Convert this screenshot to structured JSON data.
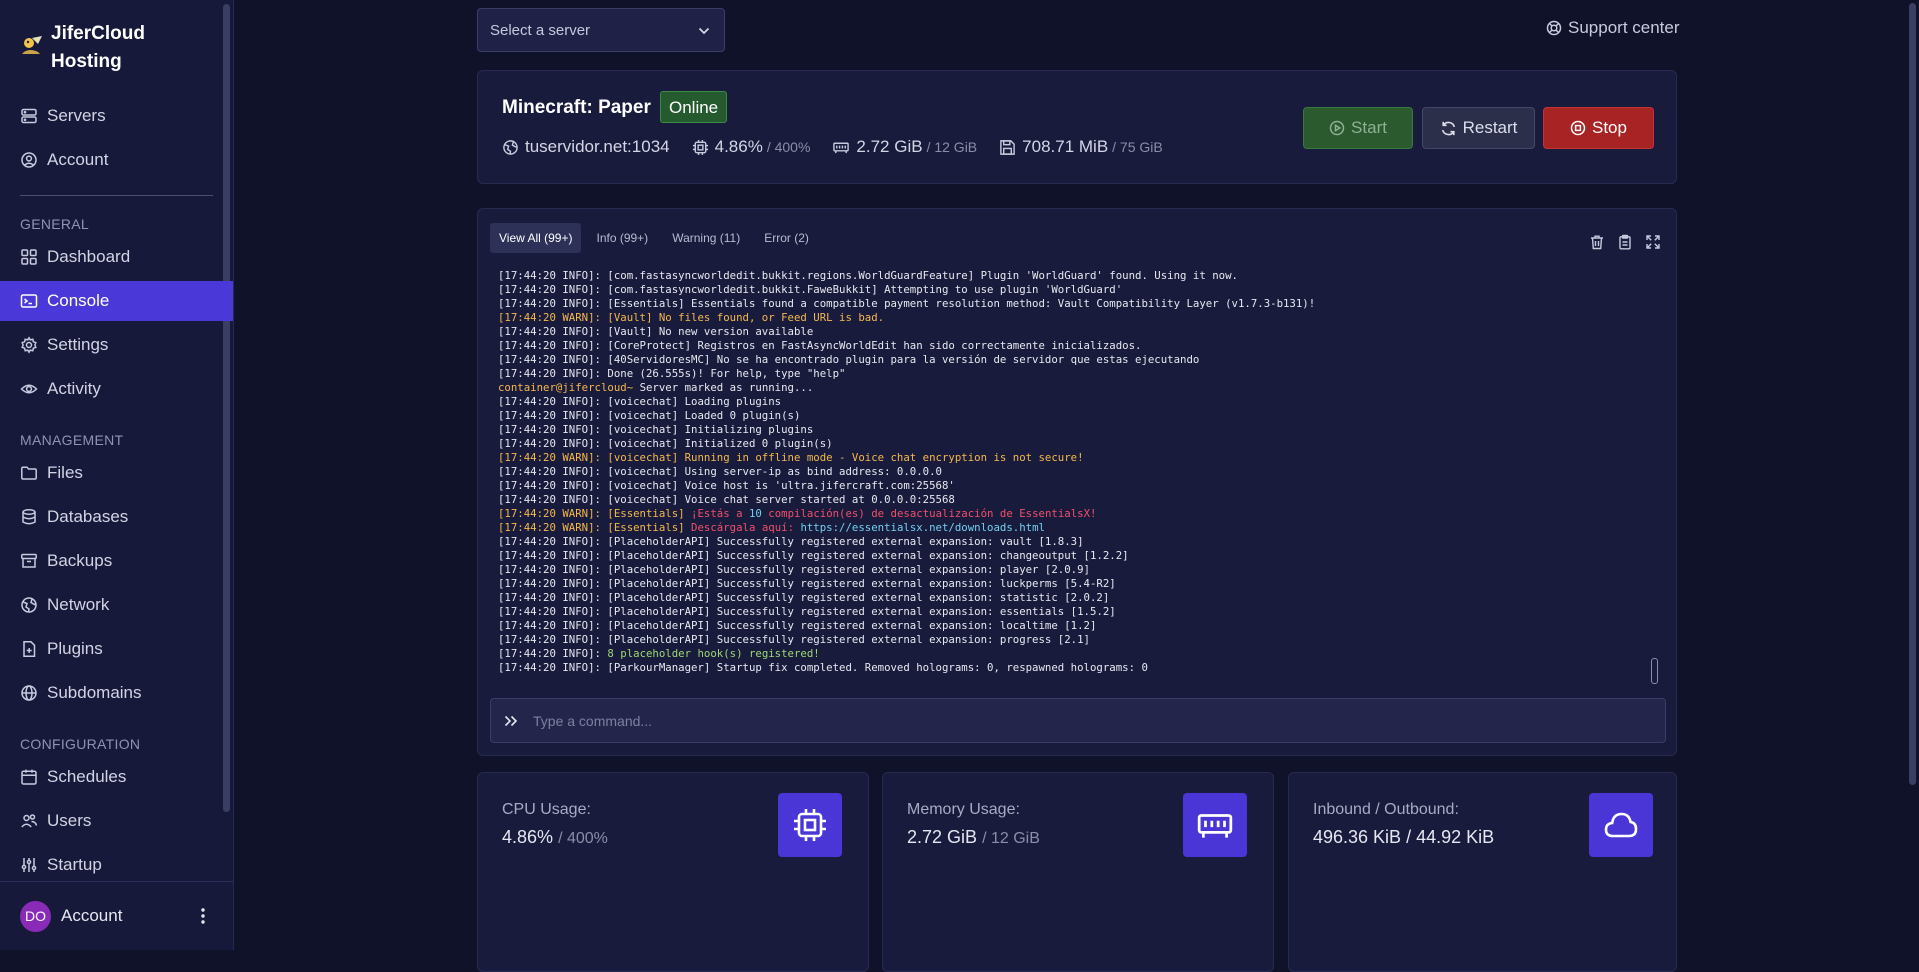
{
  "brand": {
    "title": "JiferCloud Hosting"
  },
  "nav": {
    "top": [
      {
        "label": "Servers",
        "icon": "server-icon"
      },
      {
        "label": "Account",
        "icon": "user-circle-icon"
      }
    ],
    "general_label": "GENERAL",
    "general": [
      {
        "label": "Dashboard",
        "icon": "grid-icon"
      },
      {
        "label": "Console",
        "icon": "terminal-icon",
        "active": true
      },
      {
        "label": "Settings",
        "icon": "gear-icon"
      },
      {
        "label": "Activity",
        "icon": "eye-icon"
      }
    ],
    "management_label": "MANAGEMENT",
    "management": [
      {
        "label": "Files",
        "icon": "folder-icon"
      },
      {
        "label": "Databases",
        "icon": "database-icon"
      },
      {
        "label": "Backups",
        "icon": "archive-icon"
      },
      {
        "label": "Network",
        "icon": "globe-network-icon"
      },
      {
        "label": "Plugins",
        "icon": "file-plus-icon"
      },
      {
        "label": "Subdomains",
        "icon": "globe-icon"
      }
    ],
    "configuration_label": "CONFIGURATION",
    "configuration": [
      {
        "label": "Schedules",
        "icon": "calendar-icon"
      },
      {
        "label": "Users",
        "icon": "users-icon"
      },
      {
        "label": "Startup",
        "icon": "sliders-icon"
      }
    ],
    "account": {
      "initials": "DO",
      "label": "Account"
    }
  },
  "header": {
    "server_select_placeholder": "Select a server",
    "support_label": "Support center"
  },
  "server": {
    "name": "Minecraft: Paper",
    "status": "Online",
    "address": "tuservidor.net:1034",
    "cpu": "4.86%",
    "cpu_limit": "/ 400%",
    "memory": "2.72 GiB",
    "memory_limit": "/ 12 GiB",
    "disk": "708.71 MiB",
    "disk_limit": "/ 75 GiB",
    "start_label": "Start",
    "restart_label": "Restart",
    "stop_label": "Stop"
  },
  "console": {
    "tabs": [
      "View All (99+)",
      "Info (99+)",
      "Warning (11)",
      "Error (2)"
    ],
    "command_placeholder": "Type a command...",
    "lines": [
      {
        "t": "[17:44:20 INFO]: [com.fastasyncworldedit.bukkit.regions.WorldGuardFeature] Plugin 'WorldGuard' found. Using it now.",
        "k": "info"
      },
      {
        "t": "[17:44:20 INFO]: [com.fastasyncworldedit.bukkit.FaweBukkit] Attempting to use plugin 'WorldGuard'",
        "k": "info"
      },
      {
        "t": "[17:44:20 INFO]: [Essentials] Essentials found a compatible payment resolution method: Vault Compatibility Layer (v1.7.3-b131)!",
        "k": "info"
      },
      {
        "t": "[17:44:20 WARN]: [Vault] No files found, or Feed URL is bad.",
        "k": "warn"
      },
      {
        "t": "[17:44:20 INFO]: [Vault] No new version available",
        "k": "info"
      },
      {
        "t": "[17:44:20 INFO]: [CoreProtect] Registros en FastAsyncWorldEdit han sido correctamente inicializados.",
        "k": "info"
      },
      {
        "t": "[17:44:20 INFO]: [40ServidoresMC] No se ha encontrado plugin para la versión de servidor que estas ejecutando",
        "k": "info"
      },
      {
        "t": "[17:44:20 INFO]: Done (26.555s)! For help, type \"help\"",
        "k": "info"
      },
      {
        "t": "Server marked as running...",
        "k": "container",
        "prefix": "container@jifercloud~ "
      },
      {
        "t": "[17:44:20 INFO]: [voicechat] Loading plugins",
        "k": "info"
      },
      {
        "t": "[17:44:20 INFO]: [voicechat] Loaded 0 plugin(s)",
        "k": "info"
      },
      {
        "t": "[17:44:20 INFO]: [voicechat] Initializing plugins",
        "k": "info"
      },
      {
        "t": "[17:44:20 INFO]: [voicechat] Initialized 0 plugin(s)",
        "k": "info"
      },
      {
        "t": "[17:44:20 WARN]: [voicechat] Running in offline mode - Voice chat encryption is not secure!",
        "k": "warn"
      },
      {
        "t": "[17:44:20 INFO]: [voicechat] Using server-ip as bind address: 0.0.0.0",
        "k": "info"
      },
      {
        "t": "[17:44:20 INFO]: [voicechat] Voice host is 'ultra.jifercraft.com:25568'",
        "k": "info"
      },
      {
        "t": "[17:44:20 INFO]: [voicechat] Voice chat server started at 0.0.0.0:25568",
        "k": "info"
      },
      {
        "t": "¡Estás a ",
        "k": "ess1",
        "prefix": "[17:44:20 WARN]: ",
        "tag": "[Essentials] ",
        "num": "10",
        "rest": " compilación(es) de desactualización de EssentialsX!"
      },
      {
        "t": "Descárgala aquí: ",
        "k": "ess2",
        "prefix": "[17:44:20 WARN]: ",
        "tag": "[Essentials] ",
        "link": "https://essentialsx.net/downloads.html"
      },
      {
        "t": "[17:44:20 INFO]: [PlaceholderAPI] Successfully registered external expansion: vault [1.8.3]",
        "k": "info"
      },
      {
        "t": "[17:44:20 INFO]: [PlaceholderAPI] Successfully registered external expansion: changeoutput [1.2.2]",
        "k": "info"
      },
      {
        "t": "[17:44:20 INFO]: [PlaceholderAPI] Successfully registered external expansion: player [2.0.9]",
        "k": "info"
      },
      {
        "t": "[17:44:20 INFO]: [PlaceholderAPI] Successfully registered external expansion: luckperms [5.4-R2]",
        "k": "info"
      },
      {
        "t": "[17:44:20 INFO]: [PlaceholderAPI] Successfully registered external expansion: statistic [2.0.2]",
        "k": "info"
      },
      {
        "t": "[17:44:20 INFO]: [PlaceholderAPI] Successfully registered external expansion: essentials [1.5.2]",
        "k": "info"
      },
      {
        "t": "[17:44:20 INFO]: [PlaceholderAPI] Successfully registered external expansion: localtime [1.2]",
        "k": "info"
      },
      {
        "t": "[17:44:20 INFO]: [PlaceholderAPI] Successfully registered external expansion: progress [2.1]",
        "k": "info"
      },
      {
        "t": "8 placeholder hook(s) registered!",
        "k": "hook",
        "prefix": "[17:44:20 INFO]: "
      },
      {
        "t": "[17:44:20 INFO]: [ParkourManager] Startup fix completed. Removed holograms: 0, respawned holograms: 0",
        "k": "info"
      }
    ]
  },
  "metrics": {
    "cpu": {
      "label": "CPU Usage:",
      "value": "4.86%",
      "limit": "/ 400%"
    },
    "memory": {
      "label": "Memory Usage:",
      "value": "2.72 GiB",
      "limit": "/ 12 GiB"
    },
    "network": {
      "label": "Inbound / Outbound:",
      "value": "496.36 KiB / 44.92 KiB"
    }
  },
  "colors": {
    "accent": "#4a39d8",
    "online": "#25592e",
    "stop": "#a82424",
    "warn": "#f5b84c",
    "error": "#f0506a"
  }
}
